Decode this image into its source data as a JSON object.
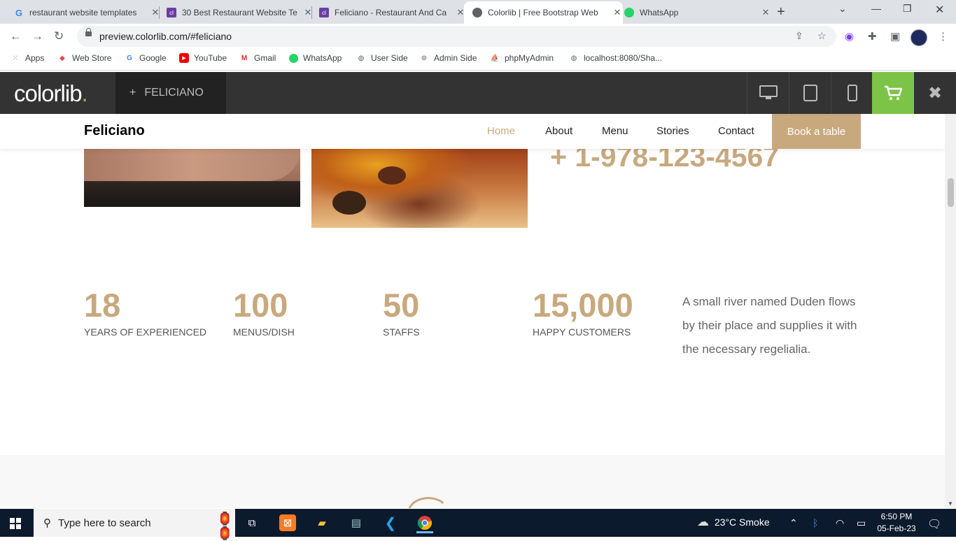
{
  "browser": {
    "tabs": [
      {
        "title": "restaurant website templates",
        "favicon": "google-icon",
        "active": false
      },
      {
        "title": "30 Best Restaurant Website Te",
        "favicon": "colorlib-icon",
        "active": false
      },
      {
        "title": "Feliciano - Restaurant And Ca",
        "favicon": "colorlib-icon",
        "active": false
      },
      {
        "title": "Colorlib | Free Bootstrap Web",
        "favicon": "globe-icon",
        "active": true
      },
      {
        "title": "WhatsApp",
        "favicon": "whatsapp-icon",
        "active": false
      }
    ],
    "url": "preview.colorlib.com/#feliciano",
    "bookmarks": [
      {
        "label": "Apps",
        "icon": "apps-grid-icon"
      },
      {
        "label": "Web Store",
        "icon": "webstore-icon"
      },
      {
        "label": "Google",
        "icon": "google-icon"
      },
      {
        "label": "YouTube",
        "icon": "youtube-icon"
      },
      {
        "label": "Gmail",
        "icon": "gmail-icon"
      },
      {
        "label": "WhatsApp",
        "icon": "whatsapp-icon"
      },
      {
        "label": "User Side",
        "icon": "globe-icon"
      },
      {
        "label": "Admin Side",
        "icon": "xampp-icon"
      },
      {
        "label": "phpMyAdmin",
        "icon": "phpmyadmin-icon"
      },
      {
        "label": "localhost:8080/Sha...",
        "icon": "globe-icon"
      }
    ]
  },
  "colorlib_bar": {
    "logo_text": "colorlib",
    "logo_dot": ".",
    "project_plus": "+",
    "project_name": "FELICIANO",
    "accent": "#7cc447"
  },
  "site": {
    "brand": "Feliciano",
    "nav": [
      {
        "label": "Home",
        "active": true
      },
      {
        "label": "About",
        "active": false
      },
      {
        "label": "Menu",
        "active": false
      },
      {
        "label": "Stories",
        "active": false
      },
      {
        "label": "Contact",
        "active": false
      }
    ],
    "book_button": "Book a table",
    "phone": "+ 1-978-123-4567",
    "stats": [
      {
        "number": "18",
        "label": "YEARS OF EXPERIENCED"
      },
      {
        "number": "100",
        "label": "MENUS/DISH"
      },
      {
        "number": "50",
        "label": "STAFFS"
      },
      {
        "number": "15,000",
        "label": "HAPPY CUSTOMERS"
      }
    ],
    "description": "A small river named Duden flows by their place and supplies it with the necessary regelialia.",
    "accent_color": "#c8a97e"
  },
  "taskbar": {
    "search_placeholder": "Type here to search",
    "weather": "23°C  Smoke",
    "time": "6:50 PM",
    "date": "05-Feb-23"
  }
}
